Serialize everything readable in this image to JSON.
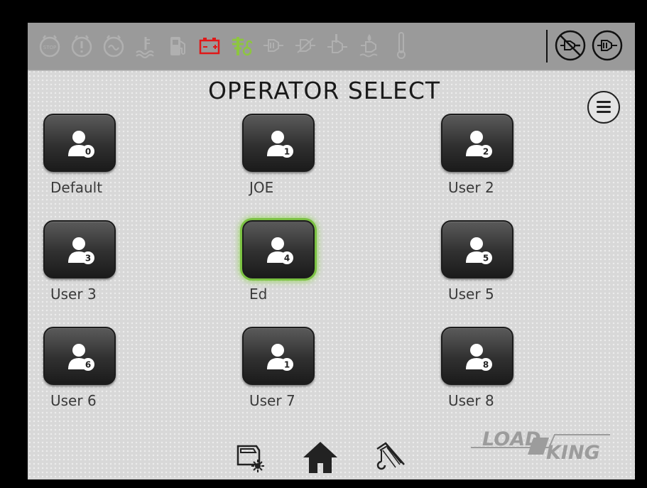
{
  "screen": {
    "title": "OPERATOR SELECT"
  },
  "status_icons": [
    {
      "name": "stop-warning-icon",
      "color": "#b0b0b0"
    },
    {
      "name": "exclamation-warning-icon",
      "color": "#b0b0b0"
    },
    {
      "name": "glow-plug-icon",
      "color": "#b0b0b0"
    },
    {
      "name": "coolant-temperature-icon",
      "color": "#b0b0b0"
    },
    {
      "name": "fuel-pump-icon",
      "color": "#b0b0b0"
    },
    {
      "name": "battery-icon",
      "color": "#e01818"
    },
    {
      "name": "regen-lock-icon",
      "color": "#8dc63f"
    },
    {
      "name": "dpf-icon",
      "color": "#b0b0b0"
    },
    {
      "name": "dpf-regen-icon",
      "color": "#b0b0b0"
    },
    {
      "name": "dpf-temp-icon",
      "color": "#b0b0b0"
    },
    {
      "name": "def-level-icon",
      "color": "#b0b0b0"
    },
    {
      "name": "thermometer-icon",
      "color": "#b0b0b0"
    },
    {
      "name": "regen-inhibit-icon",
      "color": "#111111"
    },
    {
      "name": "regen-request-icon",
      "color": "#111111"
    }
  ],
  "operators": [
    {
      "label": "Default",
      "badge": "0",
      "selected": false
    },
    {
      "label": "JOE",
      "badge": "1",
      "selected": false
    },
    {
      "label": "User 2",
      "badge": "2",
      "selected": false
    },
    {
      "label": "User 3",
      "badge": "3",
      "selected": false
    },
    {
      "label": "Ed",
      "badge": "4",
      "selected": true
    },
    {
      "label": "User 5",
      "badge": "5",
      "selected": false
    },
    {
      "label": "User 6",
      "badge": "6",
      "selected": false
    },
    {
      "label": "User 7",
      "badge": "1",
      "selected": false
    },
    {
      "label": "User 8",
      "badge": "8",
      "selected": false
    }
  ],
  "bottom_nav": [
    {
      "name": "cab-lights-icon"
    },
    {
      "name": "home-icon"
    },
    {
      "name": "crane-hook-icon"
    }
  ],
  "logo": {
    "text_1": "LOAD",
    "text_2": "KING"
  },
  "colors": {
    "selected_glow": "#8cd14d",
    "battery_alert": "#e01818",
    "active_green": "#8dc63f"
  }
}
